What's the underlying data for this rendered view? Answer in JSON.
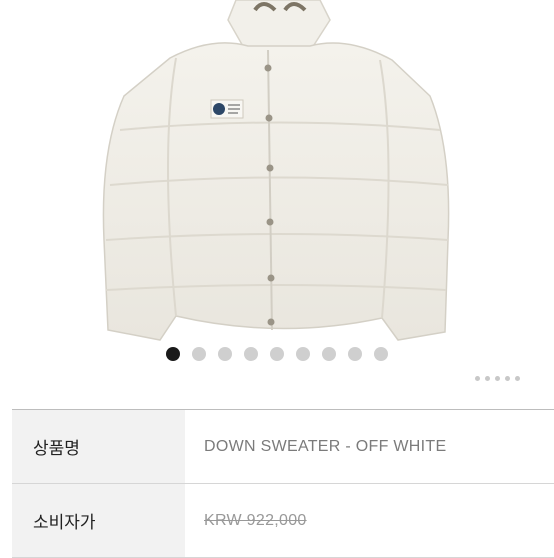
{
  "product": {
    "image_alt": "off-white down puffer jacket",
    "brand_patch_icon": "globe-patch-icon"
  },
  "carousel": {
    "total": 9,
    "active_index": 0
  },
  "specs": [
    {
      "label": "상품명",
      "value": "DOWN SWEATER - OFF WHITE",
      "strike": false
    },
    {
      "label": "소비자가",
      "value": "KRW 922,000",
      "strike": true
    }
  ]
}
